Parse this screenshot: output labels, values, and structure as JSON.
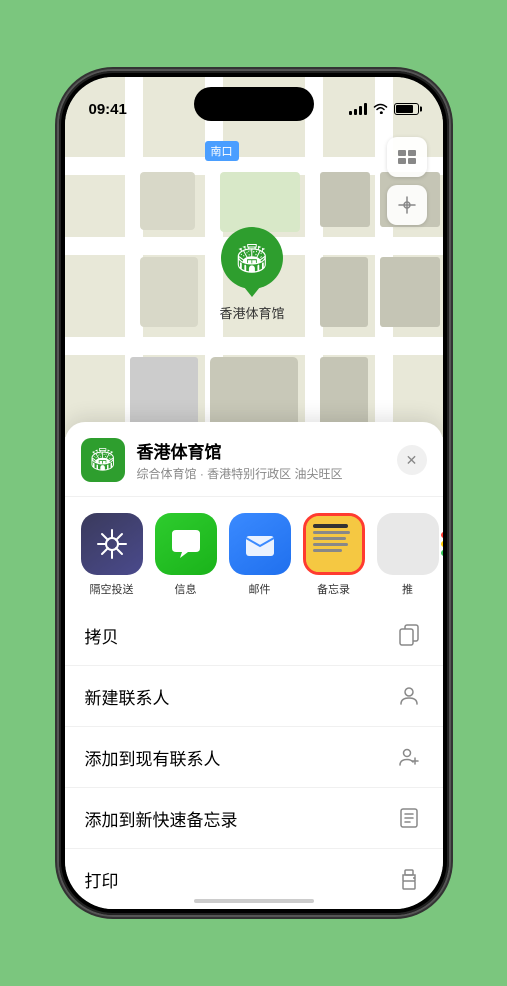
{
  "statusBar": {
    "time": "09:41",
    "timeArrow": "▶"
  },
  "map": {
    "label": "南口"
  },
  "locationPin": {
    "name": "香港体育馆",
    "pinDot": "•"
  },
  "locationHeader": {
    "name": "香港体育馆",
    "description": "综合体育馆 · 香港特别行政区 油尖旺区"
  },
  "shareApps": [
    {
      "id": "airdrop",
      "label": "隔空投送"
    },
    {
      "id": "messages",
      "label": "信息"
    },
    {
      "id": "mail",
      "label": "邮件"
    },
    {
      "id": "notes",
      "label": "备忘录"
    },
    {
      "id": "more",
      "label": "推"
    }
  ],
  "actions": [
    {
      "label": "拷贝",
      "icon": "copy"
    },
    {
      "label": "新建联系人",
      "icon": "person"
    },
    {
      "label": "添加到现有联系人",
      "icon": "person-add"
    },
    {
      "label": "添加到新快速备忘录",
      "icon": "note"
    },
    {
      "label": "打印",
      "icon": "printer"
    }
  ]
}
